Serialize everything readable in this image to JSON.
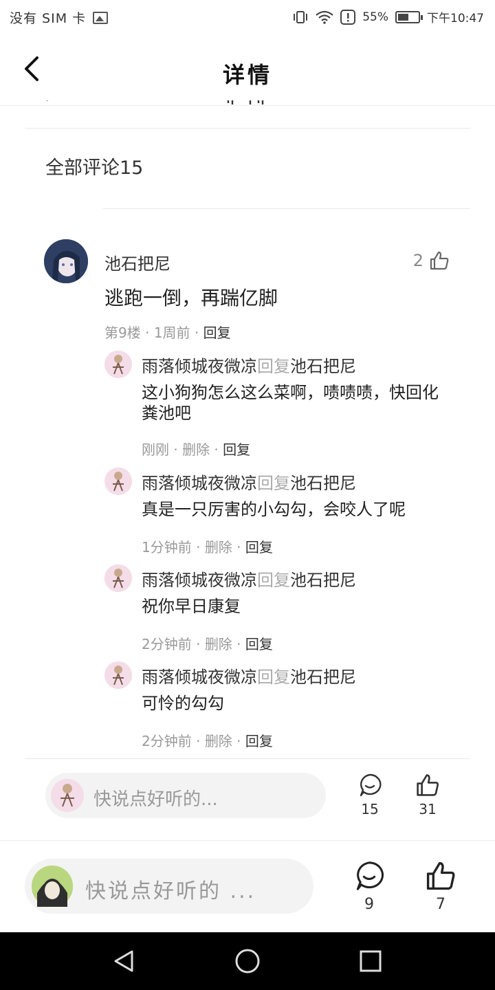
{
  "status_bar": {
    "carrier": "没有 SIM 卡",
    "battery": "55%",
    "battery_level": 0.55,
    "time": "下午10:47"
  },
  "header": {
    "title": "详情"
  },
  "comments_header": "全部评论15",
  "main_comment": {
    "username": "池石把尼",
    "likes": "2",
    "content": "逃跑一倒，再踹亿脚",
    "floor": "第9楼",
    "time": "1周前",
    "reply_label": "回复"
  },
  "replies": [
    {
      "user": "雨落倾城夜微凉",
      "reply_word": "回复",
      "target": "池石把尼",
      "text": "这小狗狗怎么这么菜啊，啧啧啧，快回化粪池吧",
      "time": "刚刚",
      "delete": "删除",
      "reply": "回复"
    },
    {
      "user": "雨落倾城夜微凉",
      "reply_word": "回复",
      "target": "池石把尼",
      "text": "真是一只厉害的小勾勾，会咬人了呢",
      "time": "1分钟前",
      "delete": "删除",
      "reply": "回复"
    },
    {
      "user": "雨落倾城夜微凉",
      "reply_word": "回复",
      "target": "池石把尼",
      "text": "祝你早日康复",
      "time": "2分钟前",
      "delete": "删除",
      "reply": "回复"
    },
    {
      "user": "雨落倾城夜微凉",
      "reply_word": "回复",
      "target": "池石把尼",
      "text": "可怜的勾勾",
      "time": "2分钟前",
      "delete": "删除",
      "reply": "回复"
    }
  ],
  "inner_input": {
    "placeholder": "快说点好听的...",
    "comment_count": "15",
    "like_count": "31"
  },
  "bottom_bar": {
    "placeholder": "快说点好听的 ...",
    "comment_count": "9",
    "like_count": "7"
  }
}
